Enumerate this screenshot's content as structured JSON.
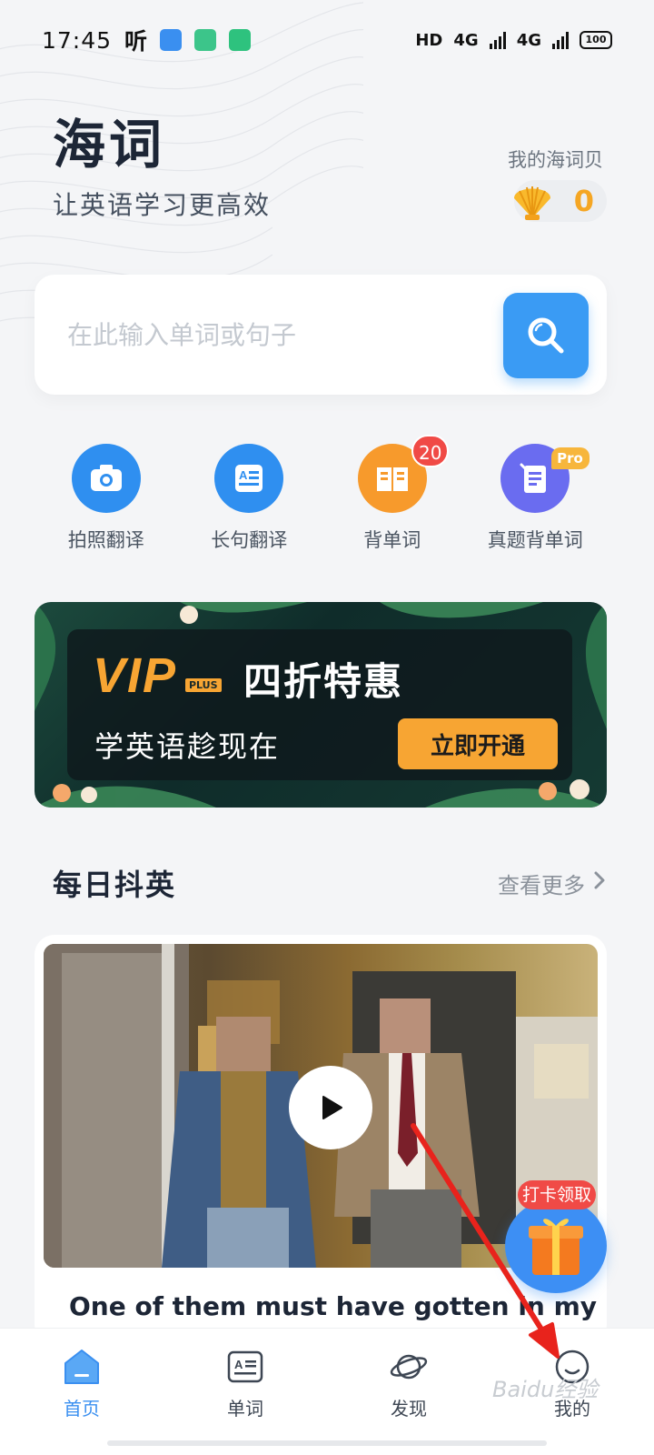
{
  "status_bar": {
    "time": "17:45",
    "app_indicator": "听",
    "network": "HD",
    "signal_1": "4G",
    "signal_2": "4G",
    "battery": "100"
  },
  "header": {
    "brand": "海词",
    "slogan": "让英语学习更高效",
    "shell_label": "我的海词贝",
    "shell_count": "0"
  },
  "search": {
    "placeholder": "在此输入单词或句子"
  },
  "features": [
    {
      "label": "拍照翻译",
      "icon": "camera-icon",
      "color": "#2f8ff0"
    },
    {
      "label": "长句翻译",
      "icon": "document-text-icon",
      "color": "#2f8ff0"
    },
    {
      "label": "背单词",
      "icon": "open-book-icon",
      "color": "#f79a2c",
      "badge": "20"
    },
    {
      "label": "真题背单词",
      "icon": "exam-paper-icon",
      "color": "#6a6cf0",
      "badge": "Pro"
    }
  ],
  "banner": {
    "vip": "VIP",
    "plus": "PLUS",
    "title": "四折特惠",
    "subtitle": "学英语趁现在",
    "cta": "立即开通"
  },
  "section": {
    "title": "每日抖英",
    "see_more": "查看更多"
  },
  "video": {
    "caption": "One of them must have gotten in my"
  },
  "gift": {
    "tag": "打卡领取"
  },
  "tabs": [
    {
      "label": "首页",
      "icon": "home-icon",
      "active": true
    },
    {
      "label": "单词",
      "icon": "word-card-icon",
      "active": false
    },
    {
      "label": "发现",
      "icon": "planet-icon",
      "active": false
    },
    {
      "label": "我的",
      "icon": "profile-icon",
      "active": false
    }
  ],
  "watermark": "Baidu经验",
  "colors": {
    "accent": "#3a9bf4",
    "orange": "#f7a533",
    "badge_red": "#f04a46",
    "background": "#f4f5f7"
  }
}
